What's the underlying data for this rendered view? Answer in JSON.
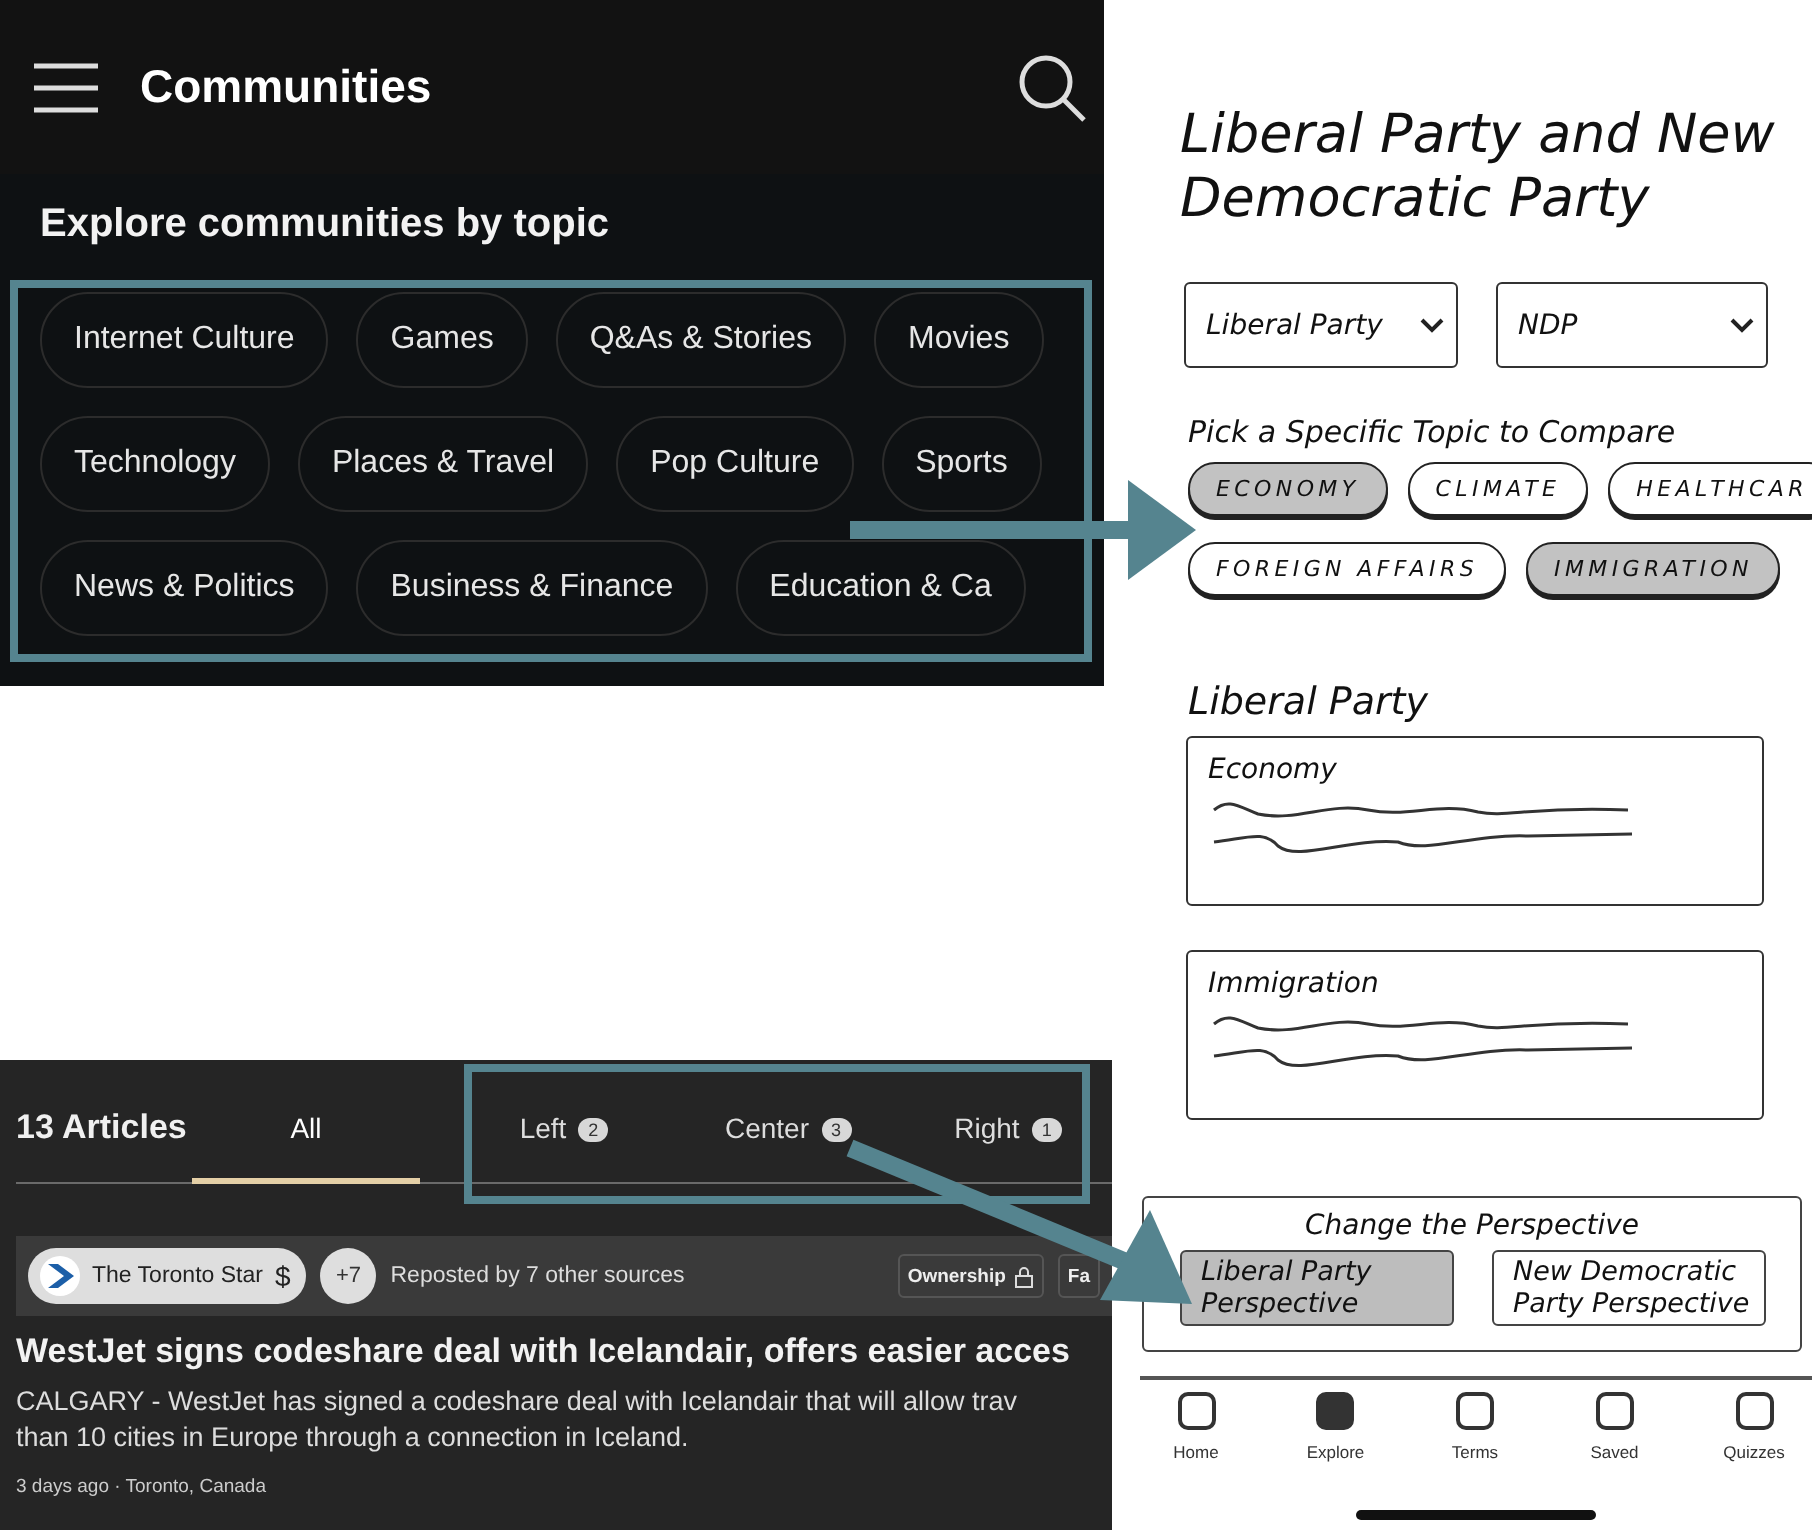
{
  "communities": {
    "title": "Communities",
    "section_title": "Explore communities by topic",
    "topic_rows": [
      [
        "Internet Culture",
        "Games",
        "Q&As & Stories",
        "Movies"
      ],
      [
        "Technology",
        "Places & Travel",
        "Pop Culture",
        "Sports"
      ],
      [
        "News & Politics",
        "Business & Finance",
        "Education & Ca"
      ]
    ]
  },
  "articles": {
    "title": "13 Articles",
    "tabs": [
      {
        "label": "All",
        "selected": true
      },
      {
        "label": "Left",
        "count": "2",
        "selected": false
      },
      {
        "label": "Center",
        "count": "3",
        "selected": false
      },
      {
        "label": "Right",
        "count": "1",
        "selected": false
      }
    ],
    "source": {
      "name": "The Toronto Star",
      "paid_mark": "$",
      "extra": "+7",
      "reposted": "Reposted by 7 other sources",
      "buttons": [
        "Ownership",
        "Fa"
      ]
    },
    "headline": "WestJet signs codeshare deal with Icelandair, offers easier acces",
    "body": "CALGARY - WestJet has signed a codeshare deal with Icelandair that will allow trav\nthan 10 cities in Europe through a connection in Iceland.",
    "meta": "3 days ago · Toronto, Canada"
  },
  "wireframe": {
    "title": "Liberal Party and New\nDemocratic Party",
    "selects": [
      "Liberal Party",
      "NDP"
    ],
    "topic_label": "Pick a Specific Topic to Compare",
    "topic_rows": [
      [
        {
          "label": "ECONOMY",
          "selected": true
        },
        {
          "label": "CLIMATE",
          "selected": false
        },
        {
          "label": "HEALTHCAR",
          "selected": false
        }
      ],
      [
        {
          "label": "FOREIGN AFFAIRS",
          "selected": false
        },
        {
          "label": "IMMIGRATION",
          "selected": true
        }
      ]
    ],
    "party_heading": "Liberal Party",
    "cards": [
      "Economy",
      "Immigration"
    ],
    "perspective": {
      "title": "Change the Perspective",
      "options": [
        {
          "label": "Liberal Party\nPerspective",
          "selected": true
        },
        {
          "label": "New Democratic\nParty Perspective",
          "selected": false
        }
      ]
    },
    "nav": [
      {
        "label": "Home",
        "selected": false
      },
      {
        "label": "Explore",
        "selected": true
      },
      {
        "label": "Terms",
        "selected": false
      },
      {
        "label": "Saved",
        "selected": false
      },
      {
        "label": "Quizzes",
        "selected": false
      }
    ]
  }
}
